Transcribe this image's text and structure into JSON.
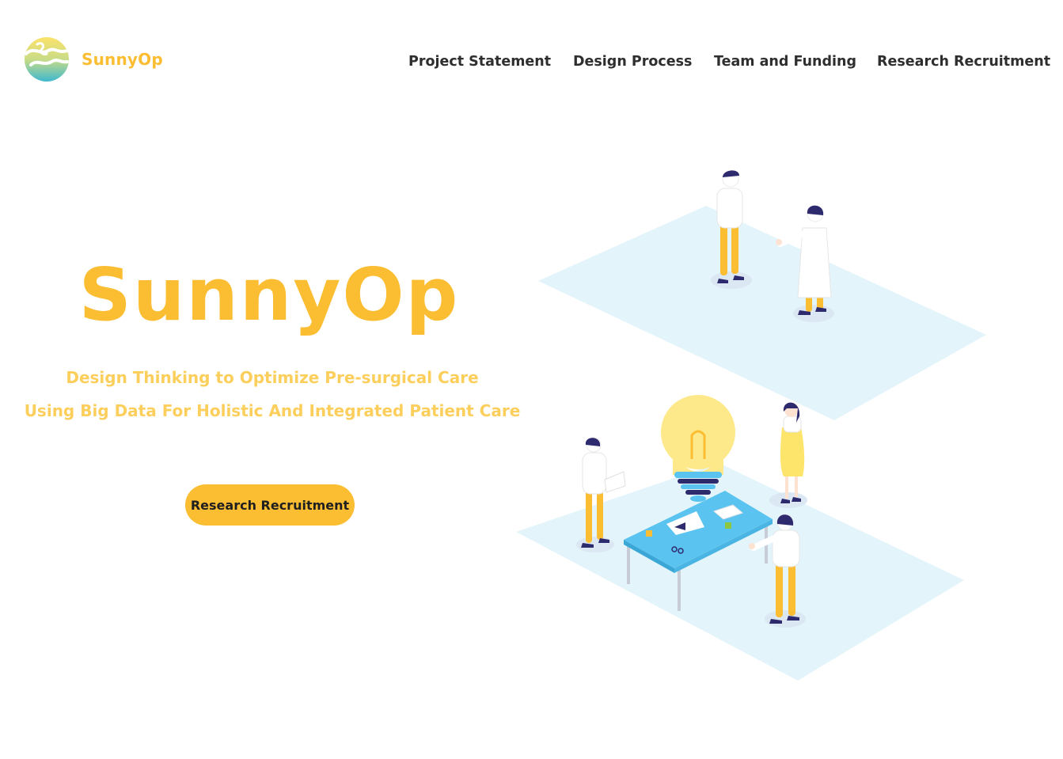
{
  "brand": {
    "name": "SunnyOp"
  },
  "nav": [
    {
      "label": "Project Statement"
    },
    {
      "label": "Design Process"
    },
    {
      "label": "Team and Funding"
    },
    {
      "label": "Research Recruitment"
    }
  ],
  "hero": {
    "title": "SunnyOp",
    "taglines": [
      "Design Thinking to Optimize Pre-surgical Care",
      "Using Big Data For Holistic And Integrated Patient Care"
    ],
    "cta_label": "Research Recruitment"
  },
  "colors": {
    "accent": "#fbbd31",
    "tagline": "#fccf5c",
    "nav_text": "#2e2e2e",
    "floor": "#e3f4fb",
    "table": "#5bc3ef"
  },
  "icons": {
    "logo": "sun-wave-logo",
    "illustration": "team-collaboration-illustration"
  }
}
